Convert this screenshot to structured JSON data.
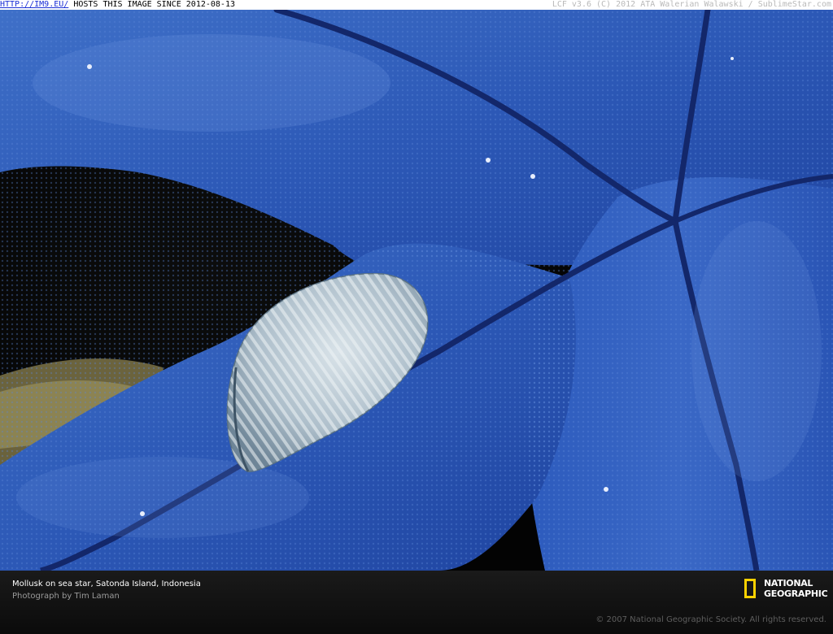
{
  "topbar": {
    "link": "HTTP://IM9.EU/",
    "hosts": " HOSTS THIS IMAGE SINCE 2012-08-13",
    "credit": "LCF v3.6 (C) 2012 ATA Walerian Walawski / SublimeStar.com"
  },
  "caption": {
    "title": "Mollusk on sea star, Satonda Island, Indonesia",
    "credit": "Photograph by Tim Laman",
    "copyright": "© 2007 National Geographic Society. All rights reserved."
  },
  "logo": {
    "line1": "NATIONAL",
    "line2": "GEOGRAPHIC"
  },
  "colors": {
    "sea_star": "#2f5cc0",
    "shell": "#c5d3dc",
    "logo_yellow": "#ffd200"
  }
}
